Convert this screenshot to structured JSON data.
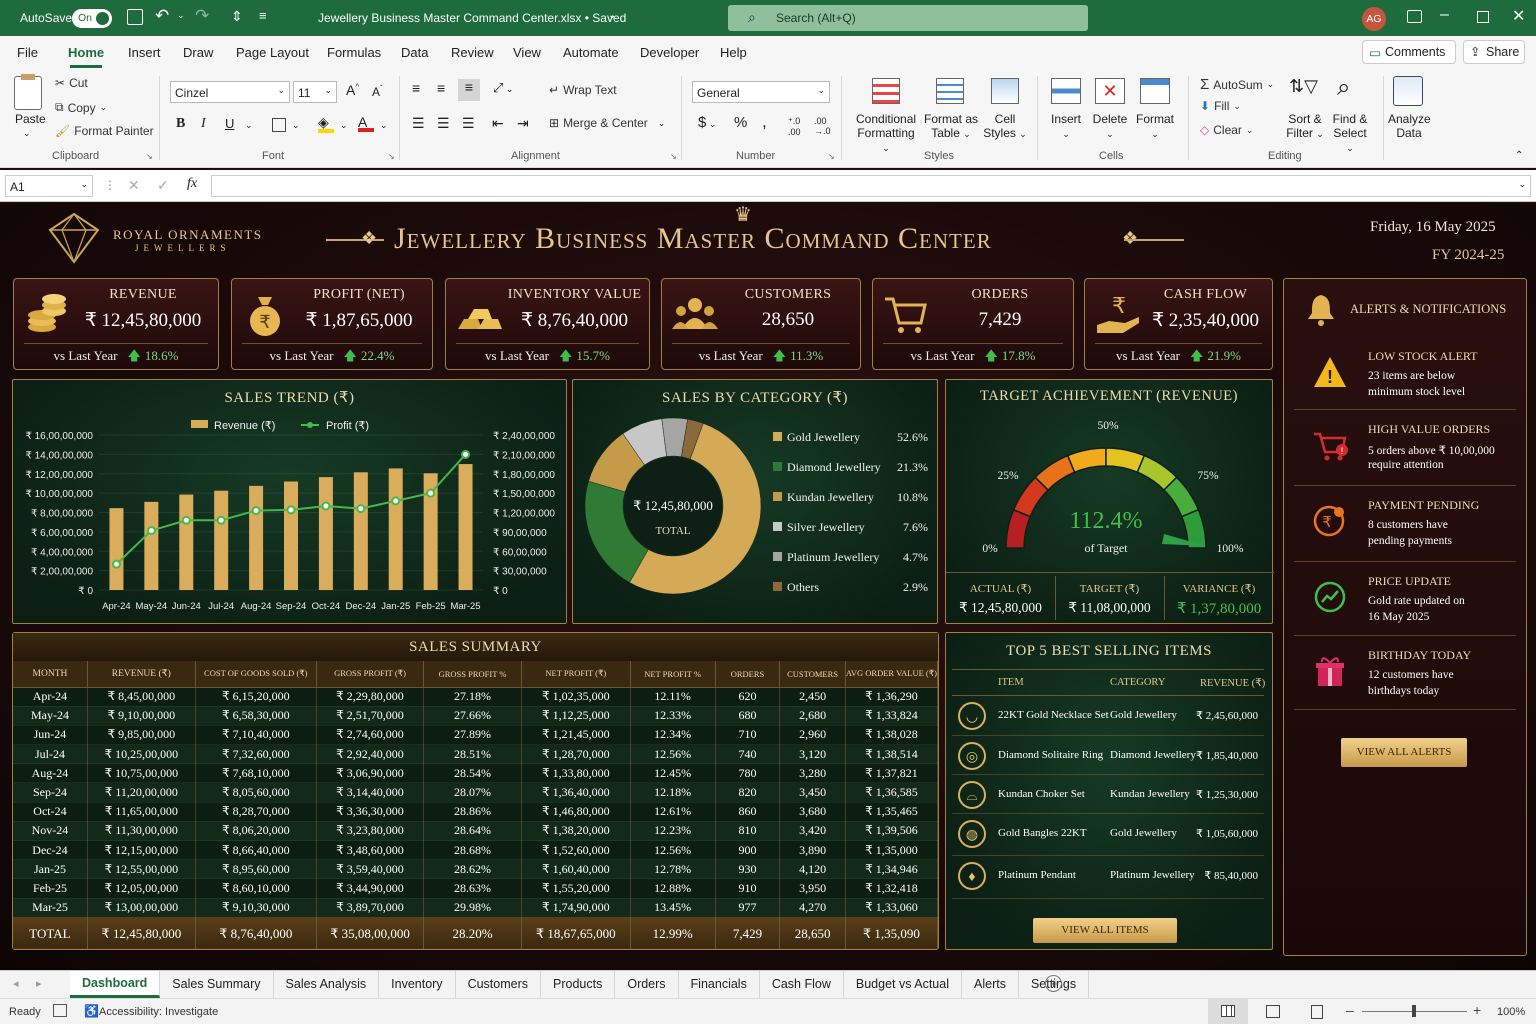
{
  "window": {
    "autosave": "AutoSave",
    "toggle": "On",
    "filename": "Jewellery Business Master Command Center.xlsx • Saved",
    "search_placeholder": "Search (Alt+Q)",
    "avatar": "AG"
  },
  "menu": {
    "items": [
      "File",
      "Home",
      "Insert",
      "Draw",
      "Page Layout",
      "Formulas",
      "Data",
      "Review",
      "View",
      "Automate",
      "Developer",
      "Help"
    ],
    "comments": "Comments",
    "share": "Share"
  },
  "ribbon": {
    "paste": "Paste",
    "cut": "Cut",
    "copy": "Copy",
    "format_painter": "Format Painter",
    "clipboard": "Clipboard",
    "font_name": "Cinzel",
    "font_size": "11",
    "font": "Font",
    "wrap_text": "Wrap Text",
    "merge_center": "Merge & Center",
    "alignment": "Alignment",
    "number_format": "General",
    "number": "Number",
    "conditional": "Conditional",
    "formatting": "Formatting",
    "format_as": "Format as",
    "table": "Table",
    "cell": "Cell",
    "styles_btn": "Styles",
    "styles": "Styles",
    "insert": "Insert",
    "delete": "Delete",
    "format": "Format",
    "cells": "Cells",
    "autosum": "AutoSum",
    "fill": "Fill",
    "clear": "Clear",
    "sort": "Sort &",
    "filter": "Filter",
    "find": "Find &",
    "select": "Select",
    "editing": "Editing",
    "analyze": "Analyze",
    "data": "Data"
  },
  "formula_bar": {
    "cell_ref": "A1",
    "fx": "fx",
    "value": ""
  },
  "header": {
    "brand_line1": "ROYAL ORNAMENTS",
    "brand_line2": "JEWELLERS",
    "title": "Jewellery Business Master Command Center",
    "date": "Friday, 16 May 2025",
    "fy": "FY 2024-25"
  },
  "kpis": [
    {
      "label": "REVENUE",
      "value": "₹ 12,45,80,000",
      "compare": "vs Last Year",
      "change": "18.6%",
      "icon": "coins-icon"
    },
    {
      "label": "PROFIT (NET)",
      "value": "₹ 1,87,65,000",
      "compare": "vs Last Year",
      "change": "22.4%",
      "icon": "money-bag-icon"
    },
    {
      "label": "INVENTORY VALUE",
      "value": "₹ 8,76,40,000",
      "compare": "vs Last Year",
      "change": "15.7%",
      "icon": "gold-bars-icon"
    },
    {
      "label": "CUSTOMERS",
      "value": "28,650",
      "compare": "vs Last Year",
      "change": "11.3%",
      "icon": "people-icon"
    },
    {
      "label": "ORDERS",
      "value": "7,429",
      "compare": "vs Last Year",
      "change": "17.8%",
      "icon": "cart-icon"
    },
    {
      "label": "CASH FLOW",
      "value": "₹ 2,35,40,000",
      "compare": "vs Last Year",
      "change": "21.9%",
      "icon": "rupee-hand-icon"
    }
  ],
  "chart_data": [
    {
      "type": "bar",
      "title": "SALES TREND (₹)",
      "legend": [
        "Revenue (₹)",
        "Profit (₹)"
      ],
      "categories": [
        "Apr-24",
        "May-24",
        "Jun-24",
        "Jul-24",
        "Aug-24",
        "Sep-24",
        "Oct-24",
        "Dec-24",
        "Jan-25",
        "Feb-25",
        "Mar-25"
      ],
      "series": [
        {
          "name": "Revenue (₹)",
          "type": "bar",
          "axis": "left",
          "values": [
            84500000,
            91000000,
            98500000,
            102500000,
            107500000,
            112000000,
            116500000,
            121500000,
            125500000,
            120500000,
            130000000
          ]
        },
        {
          "name": "Profit (₹)",
          "type": "line",
          "axis": "right",
          "values": [
            40000000,
            92000000,
            108000000,
            108000000,
            123000000,
            124000000,
            130000000,
            126000000,
            138000000,
            150000000,
            210000000
          ]
        }
      ],
      "left_ticks": [
        "₹ 16,00,00,000",
        "₹ 14,00,00,000",
        "₹ 12,00,00,000",
        "₹ 10,00,00,000",
        "₹ 8,00,00,000",
        "₹ 6,00,00,000",
        "₹ 4,00,00,000",
        "₹ 2,00,00,000",
        "₹ 0"
      ],
      "right_ticks": [
        "₹ 2,40,00,000",
        "₹ 2,10,00,000",
        "₹ 1,80,00,000",
        "₹ 1,50,00,000",
        "₹ 1,20,00,000",
        "₹ 90,00,000",
        "₹ 60,00,000",
        "₹ 30,00,000",
        "₹ 0"
      ],
      "ylim": [
        0,
        160000000
      ],
      "y2lim": [
        0,
        24000000
      ]
    },
    {
      "type": "pie",
      "title": "SALES BY CATEGORY (₹)",
      "center_value": "₹ 12,45,80,000",
      "center_label": "TOTAL",
      "categories": [
        "Gold Jewellery",
        "Diamond Jewellery",
        "Kundan Jewellery",
        "Silver Jewellery",
        "Platinum Jewellery",
        "Others"
      ],
      "values": [
        52.6,
        21.3,
        10.8,
        7.6,
        4.7,
        2.9
      ],
      "labels": [
        "52.6%",
        "21.3%",
        "10.8%",
        "7.6%",
        "4.7%",
        "2.9%"
      ],
      "colors": [
        "#d6aa55",
        "#2f7a34",
        "#c9a04a",
        "#cfcfcf",
        "#a8a8a8",
        "#8c6a3a"
      ]
    },
    {
      "type": "gauge",
      "title": "TARGET ACHIEVEMENT (REVENUE)",
      "value": 112.4,
      "value_label": "112.4%",
      "sub": "of Target",
      "ticks": [
        "0%",
        "25%",
        "50%",
        "75%",
        "100%"
      ],
      "actual_label": "ACTUAL (₹)",
      "actual": "₹ 12,45,80,000",
      "target_label": "TARGET (₹)",
      "target": "₹ 11,08,00,000",
      "variance_label": "VARIANCE (₹)",
      "variance": "₹ 1,37,80,000"
    }
  ],
  "summary": {
    "title": "SALES SUMMARY",
    "columns": [
      "MONTH",
      "REVENUE (₹)",
      "COST OF GOODS SOLD (₹)",
      "GROSS PROFIT (₹)",
      "GROSS PROFIT %",
      "NET PROFIT (₹)",
      "NET PROFIT %",
      "ORDERS",
      "CUSTOMERS",
      "AVG ORDER VALUE (₹)"
    ],
    "rows": [
      [
        "Apr-24",
        "₹ 8,45,00,000",
        "₹ 6,15,20,000",
        "₹ 2,29,80,000",
        "27.18%",
        "₹ 1,02,35,000",
        "12.11%",
        "620",
        "2,450",
        "₹ 1,36,290"
      ],
      [
        "May-24",
        "₹ 9,10,00,000",
        "₹ 6,58,30,000",
        "₹ 2,51,70,000",
        "27.66%",
        "₹ 1,12,25,000",
        "12.33%",
        "680",
        "2,680",
        "₹ 1,33,824"
      ],
      [
        "Jun-24",
        "₹ 9,85,00,000",
        "₹ 7,10,40,000",
        "₹ 2,74,60,000",
        "27.89%",
        "₹ 1,21,45,000",
        "12.34%",
        "710",
        "2,960",
        "₹ 1,38,028"
      ],
      [
        "Jul-24",
        "₹ 10,25,00,000",
        "₹ 7,32,60,000",
        "₹ 2,92,40,000",
        "28.51%",
        "₹ 1,28,70,000",
        "12.56%",
        "740",
        "3,120",
        "₹ 1,38,514"
      ],
      [
        "Aug-24",
        "₹ 10,75,00,000",
        "₹ 7,68,10,000",
        "₹ 3,06,90,000",
        "28.54%",
        "₹ 1,33,80,000",
        "12.45%",
        "780",
        "3,280",
        "₹ 1,37,821"
      ],
      [
        "Sep-24",
        "₹ 11,20,00,000",
        "₹ 8,05,60,000",
        "₹ 3,14,40,000",
        "28.07%",
        "₹ 1,36,40,000",
        "12.18%",
        "820",
        "3,450",
        "₹ 1,36,585"
      ],
      [
        "Oct-24",
        "₹ 11,65,00,000",
        "₹ 8,28,70,000",
        "₹ 3,36,30,000",
        "28.86%",
        "₹ 1,46,80,000",
        "12.61%",
        "860",
        "3,680",
        "₹ 1,35,465"
      ],
      [
        "Nov-24",
        "₹ 11,30,00,000",
        "₹ 8,06,20,000",
        "₹ 3,23,80,000",
        "28.64%",
        "₹ 1,38,20,000",
        "12.23%",
        "810",
        "3,420",
        "₹ 1,39,506"
      ],
      [
        "Dec-24",
        "₹ 12,15,00,000",
        "₹ 8,66,40,000",
        "₹ 3,48,60,000",
        "28.68%",
        "₹ 1,52,60,000",
        "12.56%",
        "900",
        "3,890",
        "₹ 1,35,000"
      ],
      [
        "Jan-25",
        "₹ 12,55,00,000",
        "₹ 8,95,60,000",
        "₹ 3,59,40,000",
        "28.62%",
        "₹ 1,60,40,000",
        "12.78%",
        "930",
        "4,120",
        "₹ 1,34,946"
      ],
      [
        "Feb-25",
        "₹ 12,05,00,000",
        "₹ 8,60,10,000",
        "₹ 3,44,90,000",
        "28.63%",
        "₹ 1,55,20,000",
        "12.88%",
        "910",
        "3,950",
        "₹ 1,32,418"
      ],
      [
        "Mar-25",
        "₹ 13,00,00,000",
        "₹ 9,10,30,000",
        "₹ 3,89,70,000",
        "29.98%",
        "₹ 1,74,90,000",
        "13.45%",
        "977",
        "4,270",
        "₹ 1,33,060"
      ]
    ],
    "total": [
      "TOTAL",
      "₹ 12,45,80,000",
      "₹ 8,76,40,000",
      "₹ 35,08,00,000",
      "28.20%",
      "₹ 18,67,65,000",
      "12.99%",
      "7,429",
      "28,650",
      "₹ 1,35,090"
    ]
  },
  "top5": {
    "title": "TOP 5 BEST SELLING ITEMS",
    "columns": [
      "ITEM",
      "CATEGORY",
      "REVENUE (₹)"
    ],
    "rows": [
      {
        "item": "22KT Gold Necklace Set",
        "category": "Gold Jewellery",
        "revenue": "₹ 2,45,60,000",
        "icon": "necklace-icon"
      },
      {
        "item": "Diamond Solitaire Ring",
        "category": "Diamond Jewellery",
        "revenue": "₹ 1,85,40,000",
        "icon": "ring-icon"
      },
      {
        "item": "Kundan Choker Set",
        "category": "Kundan Jewellery",
        "revenue": "₹ 1,25,30,000",
        "icon": "choker-icon"
      },
      {
        "item": "Gold Bangles 22KT",
        "category": "Gold Jewellery",
        "revenue": "₹ 1,05,60,000",
        "icon": "bangles-icon"
      },
      {
        "item": "Platinum Pendant",
        "category": "Platinum Jewellery",
        "revenue": "₹ 85,40,000",
        "icon": "pendant-icon"
      }
    ],
    "button": "VIEW ALL ITEMS"
  },
  "alerts": {
    "title": "ALERTS & NOTIFICATIONS",
    "items": [
      {
        "title": "LOW STOCK ALERT",
        "line1": "23 items are below",
        "line2": "minimum stock level",
        "icon": "warning-icon"
      },
      {
        "title": "HIGH VALUE ORDERS",
        "line1": "5 orders above ₹ 10,00,000",
        "line2": "require attention",
        "icon": "cart-alert-icon"
      },
      {
        "title": "PAYMENT PENDING",
        "line1": "8 customers have",
        "line2": "pending payments",
        "icon": "payment-icon"
      },
      {
        "title": "PRICE UPDATE",
        "line1": "Gold rate updated on",
        "line2": "16 May 2025",
        "icon": "trend-icon"
      },
      {
        "title": "BIRTHDAY TODAY",
        "line1": "12 customers have",
        "line2": "birthdays today",
        "icon": "gift-icon"
      }
    ],
    "button": "VIEW ALL ALERTS"
  },
  "sheets": [
    "Dashboard",
    "Sales Summary",
    "Sales Analysis",
    "Inventory",
    "Customers",
    "Products",
    "Orders",
    "Financials",
    "Cash Flow",
    "Budget vs Actual",
    "Alerts",
    "Settings"
  ],
  "status": {
    "ready": "Ready",
    "accessibility": "Accessibility: Investigate",
    "zoom": "100%"
  }
}
